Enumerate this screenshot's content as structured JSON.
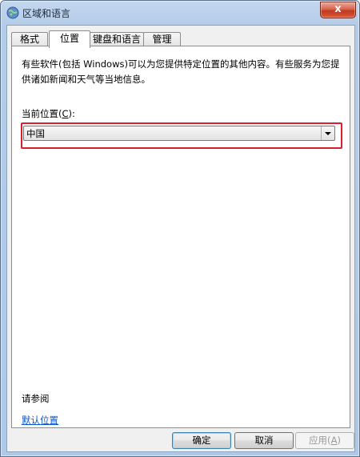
{
  "window": {
    "title": "区域和语言",
    "close_label": "x"
  },
  "tabs": [
    {
      "label": "格式"
    },
    {
      "label": "位置"
    },
    {
      "label": "键盘和语言"
    },
    {
      "label": "管理"
    }
  ],
  "panel": {
    "description_line1": "有些软件(包括 Windows)可以为您提供特定位置的其他内容。有些服务为您提",
    "description_line2": "供诸如新闻和天气等当地信息。",
    "location_label_prefix": "当前位置(",
    "location_label_key": "C",
    "location_label_suffix": "):",
    "location_value": "中国",
    "see_also": "请参阅",
    "default_location_link": "默认位置"
  },
  "buttons": {
    "ok": "确定",
    "cancel": "取消",
    "apply_prefix": "应用(",
    "apply_key": "A",
    "apply_suffix": ")"
  },
  "colors": {
    "highlight": "#d6202f",
    "link": "#0b57c8"
  }
}
